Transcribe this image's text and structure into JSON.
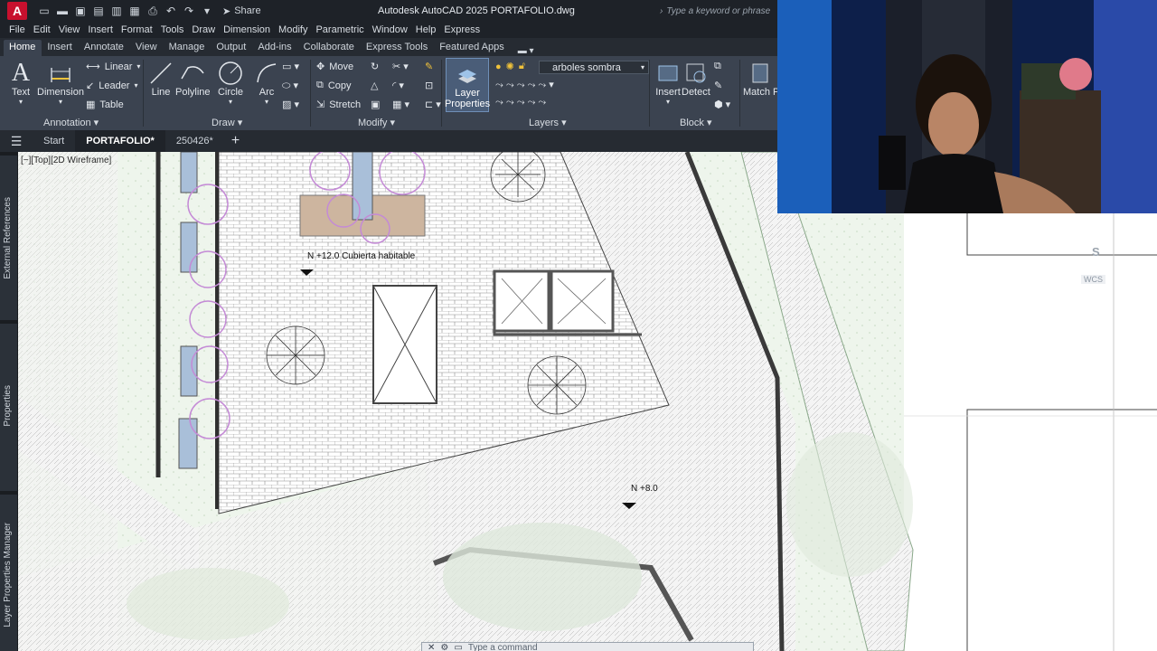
{
  "titlebar": {
    "logo": "A",
    "share": "Share",
    "title": "Autodesk AutoCAD 2025   PORTAFOLIO.dwg",
    "search_placeholder": "Type a keyword or phrase"
  },
  "menu": [
    "File",
    "Edit",
    "View",
    "Insert",
    "Format",
    "Tools",
    "Draw",
    "Dimension",
    "Modify",
    "Parametric",
    "Window",
    "Help",
    "Express"
  ],
  "ribbon_tabs": [
    "Home",
    "Insert",
    "Annotate",
    "View",
    "Manage",
    "Output",
    "Add-ins",
    "Collaborate",
    "Express Tools",
    "Featured Apps"
  ],
  "ribbon": {
    "annotation": {
      "label": "Annotation",
      "text": "Text",
      "dimension": "Dimension",
      "linear": "Linear",
      "leader": "Leader",
      "table": "Table"
    },
    "draw": {
      "label": "Draw",
      "line": "Line",
      "polyline": "Polyline",
      "circle": "Circle",
      "arc": "Arc"
    },
    "modify": {
      "label": "Modify",
      "move": "Move",
      "copy": "Copy",
      "stretch": "Stretch"
    },
    "layers": {
      "label": "Layers",
      "layer_properties": "Layer Properties",
      "current_layer": "arboles sombra"
    },
    "block": {
      "label": "Block",
      "insert": "Insert",
      "detect": "Detect",
      "match_properties": "Match Properties"
    }
  },
  "file_tabs": {
    "start": "Start",
    "active": "PORTAFOLIO*",
    "other": "250426*"
  },
  "palettes": [
    "External References",
    "Properties",
    "Layer Properties Manager"
  ],
  "viewport_label": "[−][Top][2D Wireframe]",
  "elevations": {
    "upper": "N +12.0 Cubierta habitable",
    "lower": "N +8.0"
  },
  "wcs_label": "WCS",
  "compass_s": "S",
  "command_placeholder": "Type a command",
  "icons": [
    "menu-icon",
    "share-icon",
    "search-icon",
    "plus-icon"
  ]
}
